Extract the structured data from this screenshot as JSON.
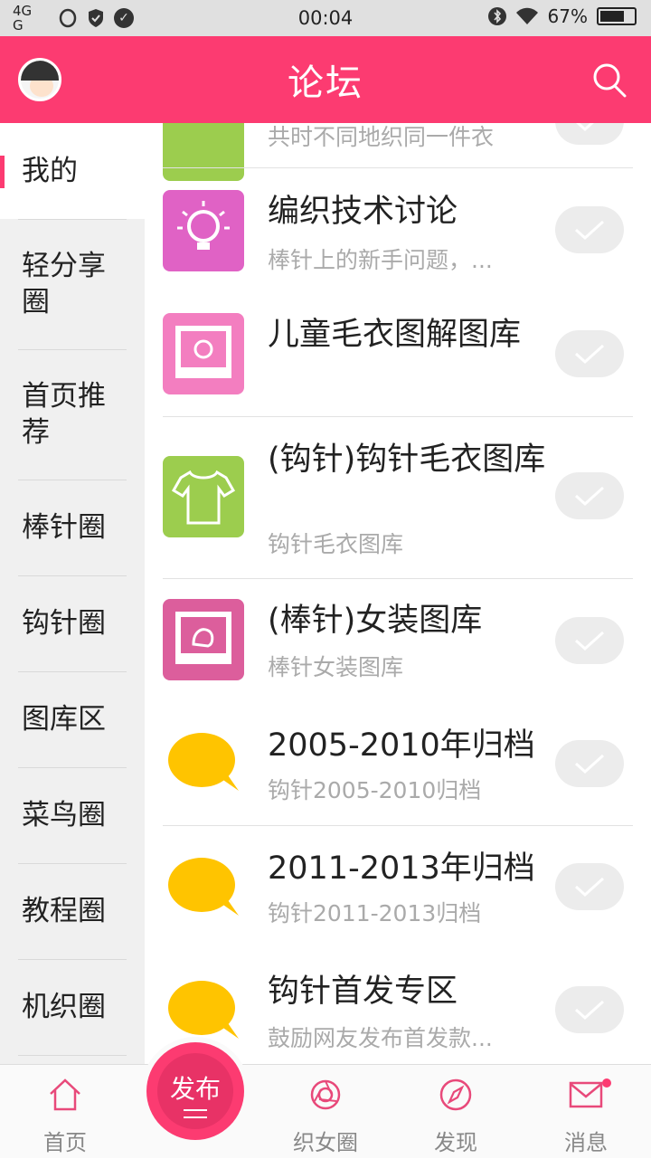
{
  "status_bar": {
    "network": "4G",
    "network2": "G",
    "time": "00:04",
    "battery": "67%"
  },
  "header": {
    "title": "论坛"
  },
  "sidebar": {
    "items": [
      {
        "label": "我的"
      },
      {
        "label": "轻分享圈"
      },
      {
        "label": "首页推荐"
      },
      {
        "label": "棒针圈"
      },
      {
        "label": "钩针圈"
      },
      {
        "label": "图库区"
      },
      {
        "label": "菜鸟圈"
      },
      {
        "label": "教程圈"
      },
      {
        "label": "机织圈"
      }
    ]
  },
  "forums": [
    {
      "title": "",
      "subtitle": "共时不同地织同一件衣",
      "icon": "shirt-icon",
      "color": "#9ccd4e"
    },
    {
      "title": "编织技术讨论",
      "subtitle": "棒针上的新手问题，...",
      "icon": "lightbulb-icon",
      "color": "#e062c5"
    },
    {
      "title": "儿童毛衣图解图库",
      "subtitle": "",
      "icon": "photo-frame-icon",
      "color": "#f37ec0"
    },
    {
      "title": "(钩针)钩针毛衣图库",
      "subtitle": "钩针毛衣图库",
      "icon": "shirt-icon",
      "color": "#9ccd4e"
    },
    {
      "title": "(棒针)女装图库",
      "subtitle": "棒针女装图库",
      "icon": "photo-frame-icon",
      "color": "#dc5e9c"
    },
    {
      "title": "2005-2010年归档",
      "subtitle": "钩针2005-2010归档",
      "icon": "chat-bubble-icon",
      "color": "#ffc400"
    },
    {
      "title": "2011-2013年归档",
      "subtitle": "钩针2011-2013归档",
      "icon": "chat-bubble-icon",
      "color": "#ffc400"
    },
    {
      "title": "钩针首发专区",
      "subtitle": "鼓励网友发布首发款...",
      "icon": "chat-bubble-icon",
      "color": "#ffc400"
    }
  ],
  "tabbar": {
    "home": "首页",
    "publish": "发布",
    "circle": "织女圈",
    "discover": "发现",
    "messages": "消息"
  },
  "colors": {
    "accent": "#fc3b71",
    "check_bg": "#ececec"
  }
}
